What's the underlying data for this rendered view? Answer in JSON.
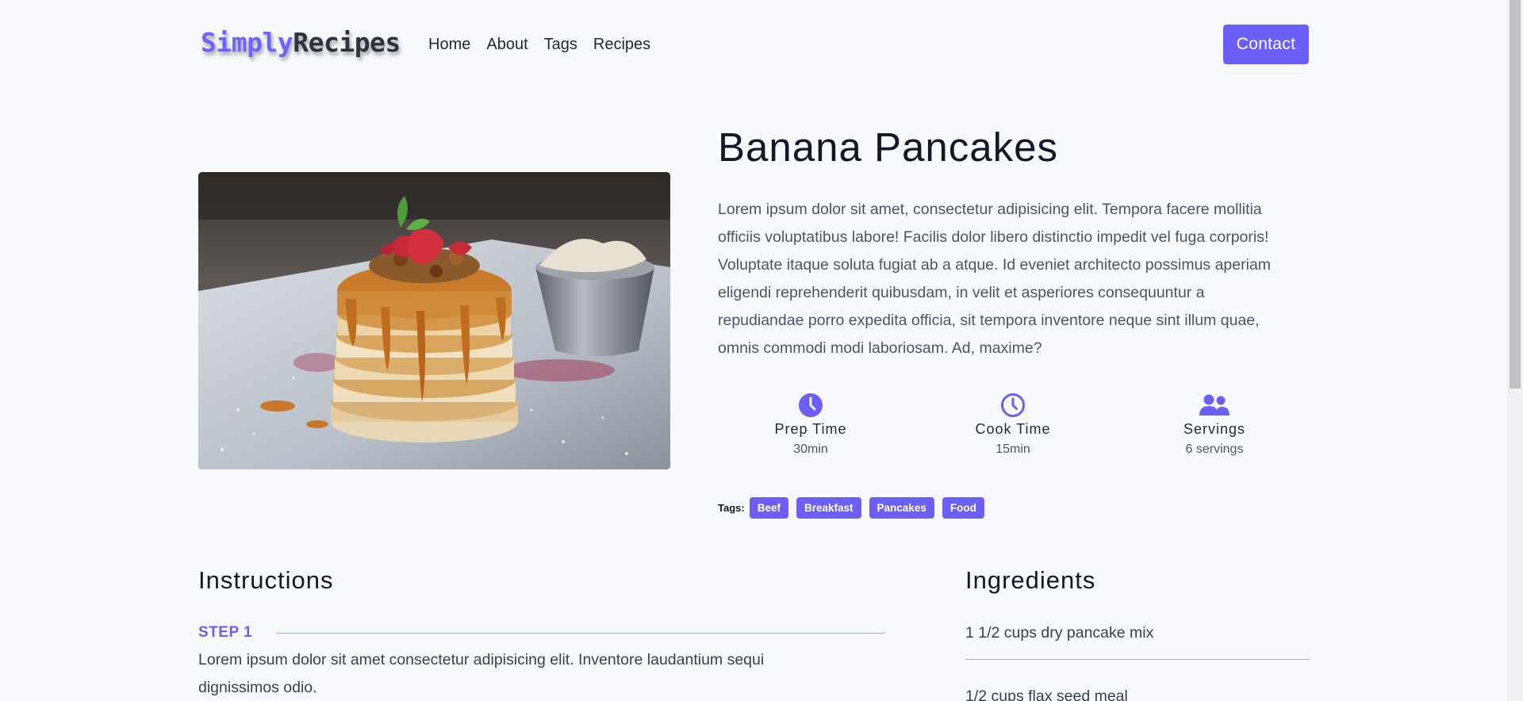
{
  "brand": {
    "part1": "Simply",
    "part2": "Recipes"
  },
  "nav": {
    "items": [
      "Home",
      "About",
      "Tags",
      "Recipes"
    ],
    "contact_label": "Contact"
  },
  "recipe": {
    "title": "Banana Pancakes",
    "image_alt": "pancakes",
    "description": "Lorem ipsum dolor sit amet, consectetur adipisicing elit. Tempora facere mollitia officiis voluptatibus labore! Facilis dolor libero distinctio impedit vel fuga corporis! Voluptate itaque soluta fugiat ab a atque. Id eveniet architecto possimus aperiam eligendi reprehenderit quibusdam, in velit et asperiores consequuntur a repudiandae porro expedita officia, sit tempora inventore neque sint illum quae, omnis commodi modi laboriosam. Ad, maxime?",
    "stats": [
      {
        "icon": "clock-solid-icon",
        "label": "Prep Time",
        "value": "30min"
      },
      {
        "icon": "clock-outline-icon",
        "label": "Cook Time",
        "value": "15min"
      },
      {
        "icon": "users-icon",
        "label": "Servings",
        "value": "6 servings"
      }
    ],
    "tags_label": "Tags:",
    "tags": [
      "Beef",
      "Breakfast",
      "Pancakes",
      "Food"
    ]
  },
  "instructions": {
    "heading": "Instructions",
    "steps": [
      {
        "label": "STEP 1",
        "text": "Lorem ipsum dolor sit amet consectetur adipisicing elit. Inventore laudantium sequi dignissimos odio."
      }
    ]
  },
  "ingredients": {
    "heading": "Ingredients",
    "items": [
      "1 1/2 cups dry pancake mix",
      "1/2 cups flax seed meal"
    ]
  },
  "colors": {
    "accent": "#6b5ff8",
    "text": "#1f2937",
    "muted": "#4b5563",
    "background": "#f8f9fc"
  }
}
